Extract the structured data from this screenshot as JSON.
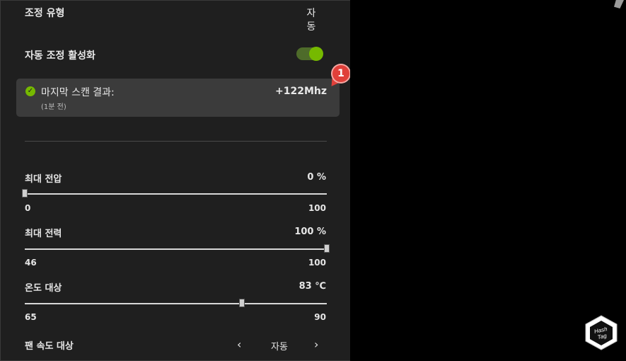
{
  "settings": {
    "type_label": "조정 유형",
    "type_value": "자동",
    "auto_label": "자동 조정 활성화",
    "auto_enabled": true
  },
  "scan": {
    "title": "마지막 스캔 결과:",
    "time": "(1분 전)",
    "value": "+122Mhz",
    "status_icon": "check-circle-icon"
  },
  "annotation": {
    "badge": "1"
  },
  "sliders": [
    {
      "label": "최대 전압",
      "value": "0 %",
      "min": "0",
      "max": "100",
      "position": 0.0
    },
    {
      "label": "최대 전력",
      "value": "100 %",
      "min": "46",
      "max": "100",
      "position": 1.0
    },
    {
      "label": "온도 대상",
      "value": "83 ℃",
      "min": "65",
      "max": "90",
      "position": 0.72
    }
  ],
  "fan": {
    "label": "팬 속도 대상",
    "value": "자동",
    "prev_icon": "chevron-left-icon",
    "next_icon": "chevron-right-icon"
  },
  "watermark": {
    "text_line1": "Hash",
    "text_line2": "Tag"
  },
  "colors": {
    "accent": "#76b900",
    "panel": "#1f1f1f",
    "card": "#3b3b3b",
    "badge": "#e0403a"
  }
}
